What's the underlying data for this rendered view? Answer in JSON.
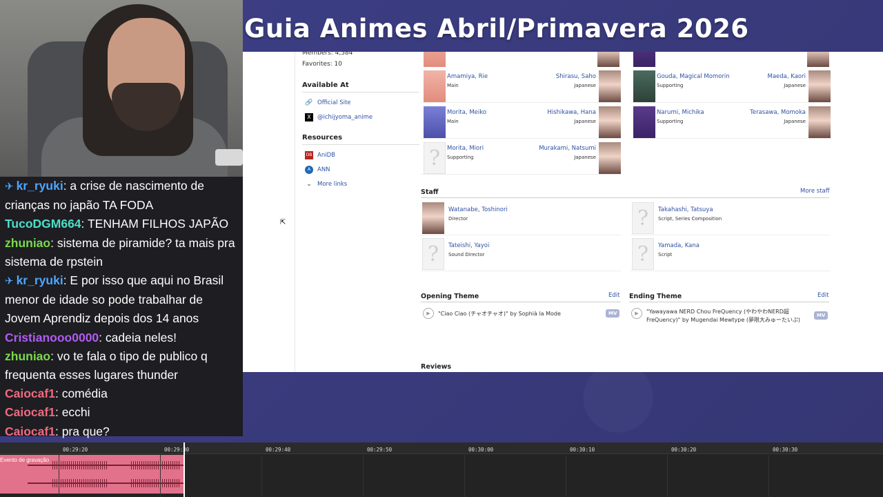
{
  "stream_title": "Guia Animes Abril/Primavera 2026",
  "chat": [
    {
      "badge": "✈",
      "user": "kr_ryuki",
      "color": "#4da6ff",
      "text": "a crise de nascimento de crianças no japão TA FODA"
    },
    {
      "user": "TucoDGM664",
      "color": "#4ce0c8",
      "text": "TENHAM FILHOS JAPÃO"
    },
    {
      "user": "zhuniao",
      "color": "#7bd94a",
      "text": "sistema de piramide? ta mais pra sistema de rpstein"
    },
    {
      "badge": "✈",
      "user": "kr_ryuki",
      "color": "#4da6ff",
      "text": "E por isso que aqui no Brasil menor de idade so pode trabalhar de Jovem Aprendiz depois dos 14 anos"
    },
    {
      "user": "Cristianooo0000",
      "color": "#b05cf0",
      "text": "cadeia neles!"
    },
    {
      "user": "zhuniao",
      "color": "#7bd94a",
      "text": "vo te fala o tipo de publico q frequenta esses lugares thunder"
    },
    {
      "user": "Caiocaf1",
      "color": "#f06a7e",
      "text": "comédia"
    },
    {
      "user": "Caiocaf1",
      "color": "#f06a7e",
      "text": "ecchi"
    },
    {
      "user": "Caiocaf1",
      "color": "#f06a7e",
      "text": "pra que?"
    }
  ],
  "sidebar": {
    "members": "Members: 4,584",
    "favorites": "Favorites: 10",
    "available_title": "Available At",
    "available": [
      {
        "icon": "link-icon",
        "label": "Official Site"
      },
      {
        "icon": "x-icon",
        "label": "@ichijyoma_anime"
      }
    ],
    "resources_title": "Resources",
    "resources": [
      {
        "icon": "anidb-icon",
        "label": "AniDB"
      },
      {
        "icon": "ann-icon",
        "label": "ANN"
      }
    ],
    "more_links": "More links"
  },
  "cast": [
    {
      "name": "Amamiya, Rie",
      "role": "Main",
      "va": "Shirasu, Saho",
      "lang": "Japanese"
    },
    {
      "name": "Gouda, Magical Momorin",
      "role": "Supporting",
      "va": "Maeda, Kaori",
      "lang": "Japanese"
    },
    {
      "name": "Morita, Meiko",
      "role": "Main",
      "va": "Hishikawa, Hana",
      "lang": "Japanese"
    },
    {
      "name": "Narumi, Michika",
      "role": "Supporting",
      "va": "Terasawa, Momoka",
      "lang": "Japanese"
    },
    {
      "name": "Morita, Miori",
      "role": "Supporting",
      "va": "Murakami, Natsumi",
      "lang": "Japanese"
    }
  ],
  "staff_title": "Staff",
  "more_staff": "More staff",
  "staff": [
    {
      "name": "Watanabe, Toshinori",
      "role": "Director"
    },
    {
      "name": "Takahashi, Tatsuya",
      "role": "Script, Series Composition"
    },
    {
      "name": "Tateishi, Yayoi",
      "role": "Sound Director"
    },
    {
      "name": "Yamada, Kana",
      "role": "Script"
    }
  ],
  "opening": {
    "title": "Opening Theme",
    "edit": "Edit",
    "song": "\"Ciao Ciao (チャオチャオ)\" by Sophià la Mode",
    "mv": "MV"
  },
  "ending": {
    "title": "Ending Theme",
    "edit": "Edit",
    "song": "\"Yawayawa NERD Chou FreQuency (やわやわNERD超FreQuency)\" by Mugendai Mewtype (夢限大みゅーたいぷ)",
    "mv": "MV"
  },
  "reviews_title": "Reviews",
  "timeline": {
    "ticks": [
      "00:29:20",
      "00:29:30",
      "00:29:40",
      "00:29:50",
      "00:30:00",
      "00:30:10",
      "00:30:20",
      "00:30:30"
    ],
    "clip_label": "Evento de gravação"
  }
}
